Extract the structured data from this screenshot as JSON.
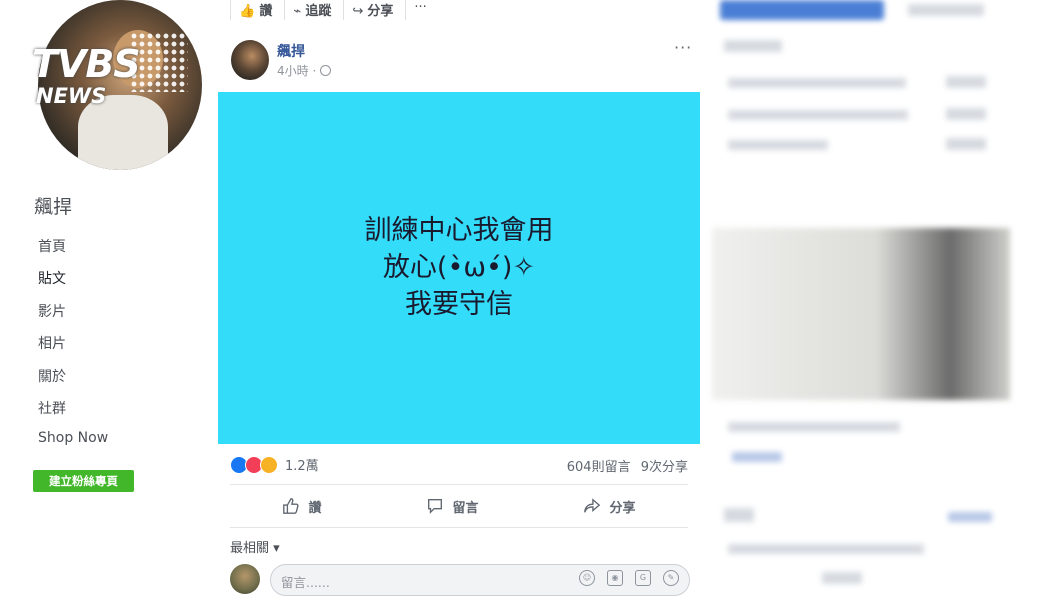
{
  "left": {
    "logo": {
      "main": "TVBS",
      "sub": "NEWS"
    },
    "page_name": "飆捍",
    "nav": [
      "首頁",
      "貼文",
      "影片",
      "相片",
      "關於",
      "社群",
      "Shop Now"
    ],
    "create_button": "建立粉絲專頁"
  },
  "post": {
    "topbar": [
      "讚",
      "追蹤",
      "分享",
      "···"
    ],
    "author": "飆捍",
    "time": "4小時",
    "more": "···",
    "image_text": [
      "訓練中心我會用",
      "放心(•̀ω•́)✧",
      "我要守信"
    ],
    "reaction_count": "1.2萬",
    "comments": "604則留言",
    "shares": "9次分享",
    "actions": {
      "like": "讚",
      "comment": "留言",
      "share": "分享"
    },
    "sort": "最相關 ▾",
    "comment_placeholder": "留言......"
  },
  "colors": {
    "image_bg": "#33dcf9",
    "link": "#365899",
    "create_btn": "#42b72a"
  }
}
